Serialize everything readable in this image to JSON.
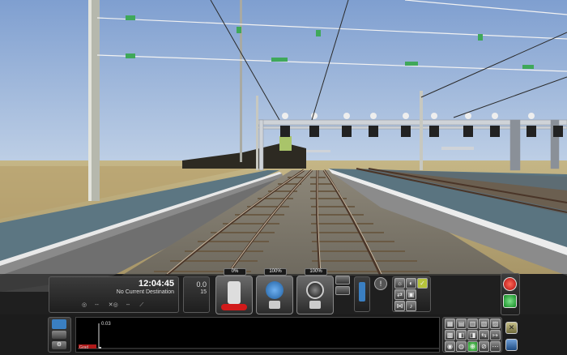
{
  "hud": {
    "clock": "12:04:45",
    "destination": "No Current Destination",
    "info_row": [
      "--",
      "--",
      ""
    ],
    "speed_value": "0.0",
    "speed_sub": "15",
    "controls": [
      {
        "name": "throttle",
        "percent_label": "0%"
      },
      {
        "name": "train-brake",
        "percent_label": "100%"
      },
      {
        "name": "loco-brake",
        "percent_label": "100%"
      }
    ],
    "graph_value": "0.03",
    "graph_label": "Grad"
  },
  "colors": {
    "sky": "#9bb7dc",
    "ground": "#b7a879",
    "platform": "#5f7884",
    "hud_dark": "#262626",
    "accent_blue": "#3a7fc2",
    "accent_red": "#d11a1a",
    "accent_green": "#20a030"
  }
}
